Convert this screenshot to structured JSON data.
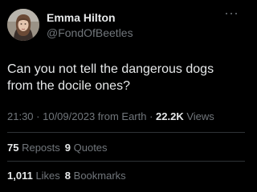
{
  "tweet": {
    "author": {
      "display_name": "Emma Hilton",
      "handle": "@FondOfBeetles",
      "avatar_icon": "avatar-photo"
    },
    "more_icon": "more-dots-icon",
    "text": "Can you not tell the dangerous dogs from the docile ones?",
    "meta": {
      "time": "21:30",
      "sep1": " · ",
      "date": "10/09/2023",
      "source": " from Earth",
      "sep2": " · ",
      "views_count": "22.2K",
      "views_label": " Views"
    },
    "stats_row1": {
      "reposts_count": "75",
      "reposts_label": " Reposts",
      "quotes_count": "9",
      "quotes_label": " Quotes"
    },
    "stats_row2": {
      "likes_count": "1,011",
      "likes_label": " Likes",
      "bookmarks_count": "8",
      "bookmarks_label": " Bookmarks"
    }
  },
  "colors": {
    "background": "#000000",
    "primary_text": "#e7e9ea",
    "secondary_text": "#71767b",
    "divider": "#2f3336"
  }
}
